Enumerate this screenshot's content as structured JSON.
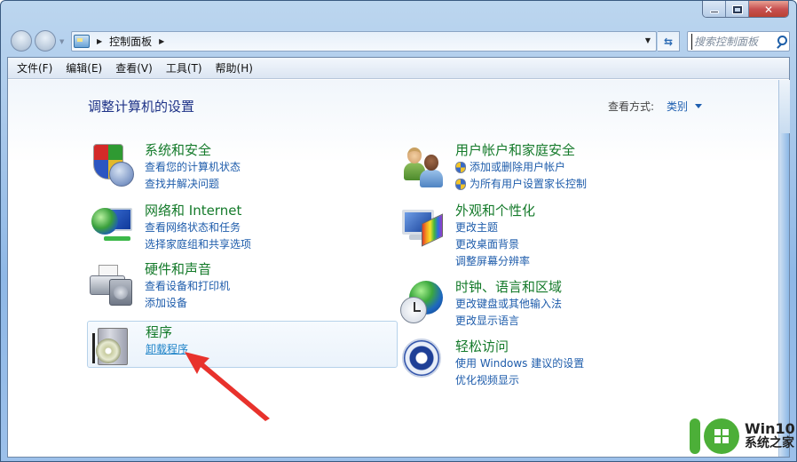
{
  "window": {
    "caption_buttons": [
      "minimize",
      "maximize",
      "close"
    ]
  },
  "navigation": {
    "back_icon": "back-arrow-icon",
    "forward_icon": "forward-arrow-icon",
    "breadcrumb": [
      "控制面板"
    ],
    "search_placeholder": "搜索控制面板"
  },
  "menubar": {
    "items": [
      "文件(F)",
      "编辑(E)",
      "查看(V)",
      "工具(T)",
      "帮助(H)"
    ]
  },
  "main": {
    "title": "调整计算机的设置",
    "view_by_label": "查看方式:",
    "view_by_value": "类别",
    "categories": [
      {
        "title": "系统和安全",
        "icon": "shield-icon",
        "links": [
          "查看您的计算机状态",
          "查找并解决问题"
        ]
      },
      {
        "title": "网络和 Internet",
        "icon": "network-icon",
        "links": [
          "查看网络状态和任务",
          "选择家庭组和共享选项"
        ]
      },
      {
        "title": "硬件和声音",
        "icon": "printer-icon",
        "links": [
          "查看设备和打印机",
          "添加设备"
        ]
      },
      {
        "title": "程序",
        "icon": "programs-icon",
        "links": [
          "卸载程序"
        ]
      },
      {
        "title": "用户帐户和家庭安全",
        "icon": "users-icon",
        "links": [
          "添加或删除用户帐户",
          "为所有用户设置家长控制"
        ]
      },
      {
        "title": "外观和个性化",
        "icon": "appearance-icon",
        "links": [
          "更改主题",
          "更改桌面背景",
          "调整屏幕分辨率"
        ]
      },
      {
        "title": "时钟、语言和区域",
        "icon": "clock-globe-icon",
        "links": [
          "更改键盘或其他输入法",
          "更改显示语言"
        ]
      },
      {
        "title": "轻松访问",
        "icon": "ease-of-access-icon",
        "links": [
          "使用 Windows 建议的设置",
          "优化视频显示"
        ]
      }
    ]
  },
  "annotation": {
    "arrow_color": "#e8322c"
  },
  "watermark": {
    "line1": "Win10",
    "line2": "系统之家",
    "color": "#4caf38"
  }
}
